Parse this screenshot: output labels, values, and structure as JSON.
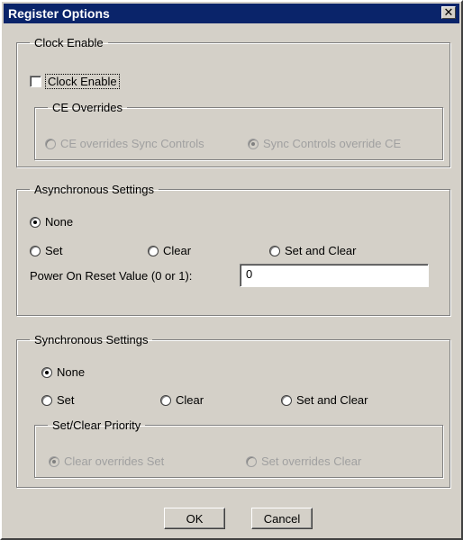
{
  "window": {
    "title": "Register Options",
    "close_glyph": "✕"
  },
  "clock_enable": {
    "legend": "Clock Enable",
    "checkbox_label": "Clock Enable",
    "checked": false,
    "ce_overrides": {
      "legend": "CE Overrides",
      "options": [
        "CE overrides Sync Controls",
        "Sync Controls override CE"
      ],
      "selected": "Sync Controls override CE",
      "enabled": false
    }
  },
  "async": {
    "legend": "Asynchronous Settings",
    "none_label": "None",
    "set_label": "Set",
    "clear_label": "Clear",
    "set_and_clear_label": "Set and Clear",
    "selected": "None",
    "por_label": "Power On Reset Value (0 or 1):",
    "por_value": "0"
  },
  "sync": {
    "legend": "Synchronous Settings",
    "none_label": "None",
    "set_label": "Set",
    "clear_label": "Clear",
    "set_and_clear_label": "Set and Clear",
    "selected": "None",
    "priority": {
      "legend": "Set/Clear Priority",
      "options": [
        "Clear overrides Set",
        "Set overrides Clear"
      ],
      "selected": "Clear overrides Set",
      "enabled": false
    }
  },
  "buttons": {
    "ok": "OK",
    "cancel": "Cancel"
  }
}
